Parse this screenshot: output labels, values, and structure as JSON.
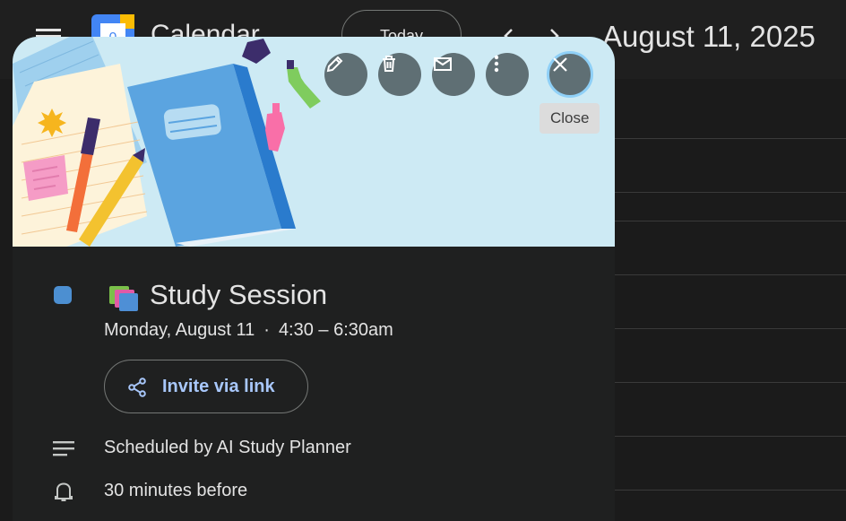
{
  "header": {
    "app_title": "Calendar",
    "today_label": "Today",
    "date_title": "August 11, 2025"
  },
  "popup": {
    "actions": {
      "close_tooltip": "Close"
    },
    "event": {
      "title": "Study Session",
      "date": "Monday, August 11",
      "separator": "·",
      "time": "4:30 – 6:30am",
      "color": "#4c8fd1",
      "invite_label": "Invite via link",
      "description": "Scheduled by AI Study Planner",
      "reminder": "30 minutes before"
    }
  },
  "icons": [
    "menu-icon",
    "calendar-logo-icon",
    "chevron-left-icon",
    "chevron-right-icon",
    "pencil-icon",
    "trash-icon",
    "mail-icon",
    "more-vert-icon",
    "close-icon",
    "books-icon",
    "share-icon",
    "notes-icon",
    "bell-icon"
  ]
}
